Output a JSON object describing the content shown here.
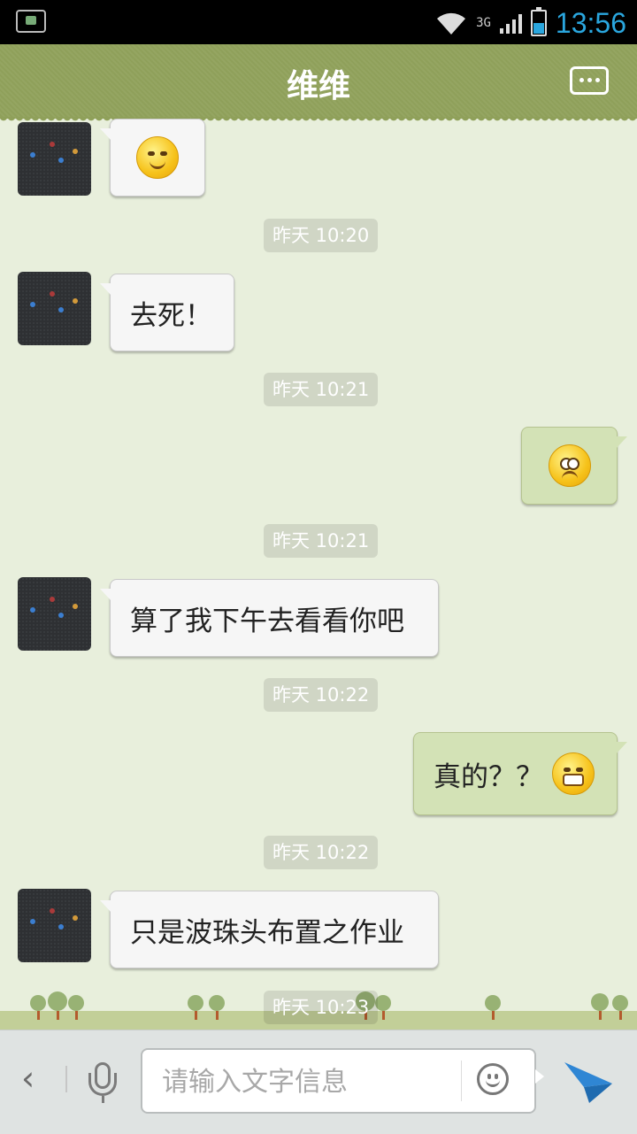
{
  "status_bar": {
    "time": "13:56",
    "network_label": "3G",
    "icons": [
      "android-debug-icon",
      "wifi-icon",
      "3g-icon",
      "signal-icon",
      "battery-icon"
    ],
    "accent_color": "#2aa6de"
  },
  "header": {
    "title": "维维",
    "menu_icon": "more-options-icon",
    "background_color": "#8fa05a"
  },
  "messages": [
    {
      "type": "emoji",
      "side": "in",
      "emoji": "smirk-emoji-icon"
    },
    {
      "type": "time",
      "text": "昨天 10:20"
    },
    {
      "type": "text",
      "side": "in",
      "text": "去死！"
    },
    {
      "type": "time",
      "text": "昨天 10:21"
    },
    {
      "type": "emoji",
      "side": "out",
      "emoji": "pitiful-emoji-icon"
    },
    {
      "type": "time",
      "text": "昨天 10:21"
    },
    {
      "type": "text",
      "side": "in",
      "text": "算了我下午去看看你吧"
    },
    {
      "type": "time",
      "text": "昨天 10:22"
    },
    {
      "type": "text",
      "side": "out",
      "text": "真的？？",
      "emoji": "grin-emoji-icon"
    },
    {
      "type": "time",
      "text": "昨天 10:22"
    },
    {
      "type": "text",
      "side": "in",
      "text": "只是波珠头布置之作业"
    },
    {
      "type": "time",
      "text": "昨天 10:23"
    }
  ],
  "input_bar": {
    "placeholder": "请输入文字信息",
    "value": "",
    "icons": [
      "back-chevron-icon",
      "microphone-icon",
      "emoji-icon",
      "send-icon"
    ]
  }
}
